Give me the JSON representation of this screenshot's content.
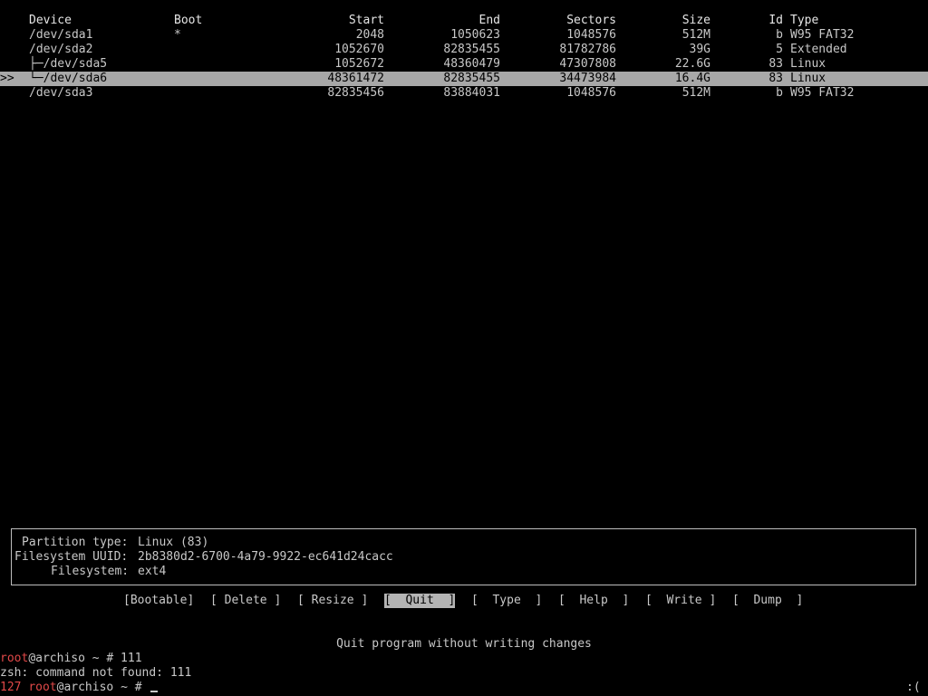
{
  "table": {
    "headers": {
      "device": "Device",
      "boot": "Boot",
      "start": "Start",
      "end": "End",
      "sectors": "Sectors",
      "size": "Size",
      "id": "Id",
      "type": "Type"
    },
    "rows": [
      {
        "marker": "",
        "device": "/dev/sda1",
        "boot": "*",
        "start": "2048",
        "end": "1050623",
        "sectors": "1048576",
        "size": "512M",
        "id": "b",
        "type": "W95 FAT32"
      },
      {
        "marker": "",
        "device": "/dev/sda2",
        "boot": "",
        "start": "1052670",
        "end": "82835455",
        "sectors": "81782786",
        "size": "39G",
        "id": "5",
        "type": "Extended"
      },
      {
        "marker": "",
        "device": "├─/dev/sda5",
        "boot": "",
        "start": "1052672",
        "end": "48360479",
        "sectors": "47307808",
        "size": "22.6G",
        "id": "83",
        "type": "Linux"
      },
      {
        "marker": ">>",
        "device": "└─/dev/sda6",
        "boot": "",
        "start": "48361472",
        "end": "82835455",
        "sectors": "34473984",
        "size": "16.4G",
        "id": "83",
        "type": "Linux"
      },
      {
        "marker": "",
        "device": "/dev/sda3",
        "boot": "",
        "start": "82835456",
        "end": "83884031",
        "sectors": "1048576",
        "size": "512M",
        "id": "b",
        "type": "W95 FAT32"
      }
    ]
  },
  "info": {
    "partition_type_label": "Partition type:",
    "partition_type_value": "Linux (83)",
    "fs_uuid_label": "Filesystem UUID:",
    "fs_uuid_value": "2b8380d2-6700-4a79-9922-ec641d24cacc",
    "filesystem_label": "Filesystem:",
    "filesystem_value": "ext4"
  },
  "menu": {
    "bootable": "[Bootable]",
    "delete": "[ Delete ]",
    "resize": "[ Resize ]",
    "quit": "[  Quit  ]",
    "type": "[  Type  ]",
    "help": "[  Help  ]",
    "write": "[  Write ]",
    "dump": "[  Dump  ]"
  },
  "help_text": "Quit program without writing changes",
  "terminal": {
    "line1_user": "root",
    "line1_rest": "@archiso ~ # 111",
    "line2": "zsh: command not found: 111",
    "line3_code": "127",
    "line3_user": "root",
    "line3_rest": "@archiso ~ # ",
    "status_face": ":("
  }
}
